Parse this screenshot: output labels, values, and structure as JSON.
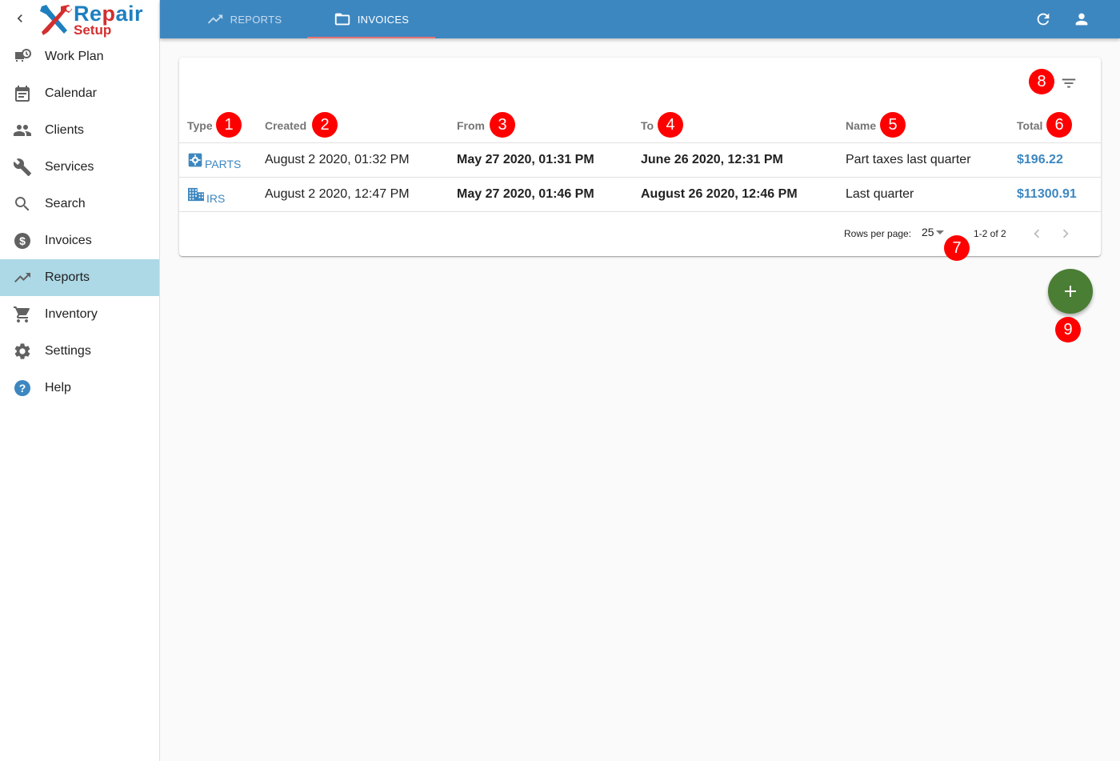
{
  "logo": {
    "line1_a": "Re",
    "line1_b": "p",
    "line1_c": "air",
    "line2": "Setup"
  },
  "sidebar": {
    "items": [
      {
        "label": "Work Plan",
        "icon": "work-plan-icon"
      },
      {
        "label": "Calendar",
        "icon": "calendar-icon"
      },
      {
        "label": "Clients",
        "icon": "clients-icon"
      },
      {
        "label": "Services",
        "icon": "wrench-icon"
      },
      {
        "label": "Search",
        "icon": "search-icon"
      },
      {
        "label": "Invoices",
        "icon": "dollar-icon"
      },
      {
        "label": "Reports",
        "icon": "trending-up-icon",
        "active": true
      },
      {
        "label": "Inventory",
        "icon": "cart-icon"
      },
      {
        "label": "Settings",
        "icon": "gear-icon"
      },
      {
        "label": "Help",
        "icon": "help-icon"
      }
    ]
  },
  "topbar": {
    "tabs": [
      {
        "label": "REPORTS",
        "icon": "trending-up-icon"
      },
      {
        "label": "INVOICES",
        "icon": "folder-icon",
        "active": true
      }
    ]
  },
  "table": {
    "headers": {
      "type": "Type",
      "created": "Created",
      "from": "From",
      "to": "To",
      "name": "Name",
      "total": "Total"
    },
    "rows": [
      {
        "type": "PARTS",
        "type_icon": "parts-gear-icon",
        "created": "August 2 2020, 01:32 PM",
        "from": "May 27 2020, 01:31 PM",
        "to": "June 26 2020, 12:31 PM",
        "name": "Part taxes last quarter",
        "total": "$196.22"
      },
      {
        "type": "IRS",
        "type_icon": "building-icon",
        "created": "August 2 2020, 12:47 PM",
        "from": "May 27 2020, 01:46 PM",
        "to": "August 26 2020, 12:46 PM",
        "name": "Last quarter",
        "total": "$11300.91"
      }
    ]
  },
  "pagination": {
    "rows_per_page_label": "Rows per page:",
    "rows_per_page_value": "25",
    "page_info": "1-2 of 2"
  },
  "markers": [
    "1",
    "2",
    "3",
    "4",
    "5",
    "6",
    "7",
    "8",
    "9"
  ],
  "colors": {
    "topbar": "#3d87c0",
    "active_nav": "#add8e6",
    "link": "#3d87c0",
    "fab": "#4a7e34",
    "marker": "#ff0000"
  }
}
